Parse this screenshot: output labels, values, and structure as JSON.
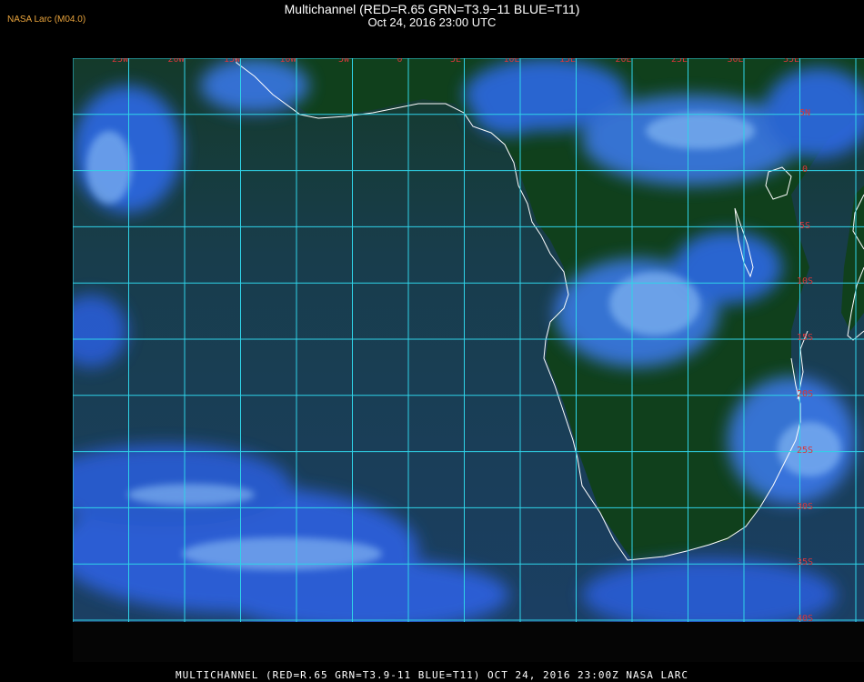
{
  "header": {
    "title": "Multichannel (RED=R.65 GRN=T3.9−11 BLUE=T11)",
    "subtitle": "Oct 24, 2016 23:00 UTC",
    "credit": "NASA Larc (M04.0)"
  },
  "footer": {
    "text": "MULTICHANNEL (RED=R.65 GRN=T3.9-11 BLUE=T11) OCT 24, 2016 23:00Z   NASA LARC"
  },
  "map": {
    "longitude_labels": [
      "25W",
      "20W",
      "15W",
      "10W",
      "5W",
      "0",
      "5E",
      "10E",
      "15E",
      "20E",
      "25E",
      "30E",
      "35E"
    ],
    "latitude_labels": [
      "5N",
      "0",
      "5S",
      "10S",
      "15S",
      "20S",
      "25S",
      "30S",
      "35S",
      "40S"
    ],
    "colors": {
      "grid": "#2fd3e8",
      "coastline": "#ffffff",
      "label": "#d8363a",
      "ocean": "#17384a",
      "land": "#123d1e",
      "cloud": "#2f6cf0",
      "cloud_bright": "#8fc1f7"
    }
  }
}
